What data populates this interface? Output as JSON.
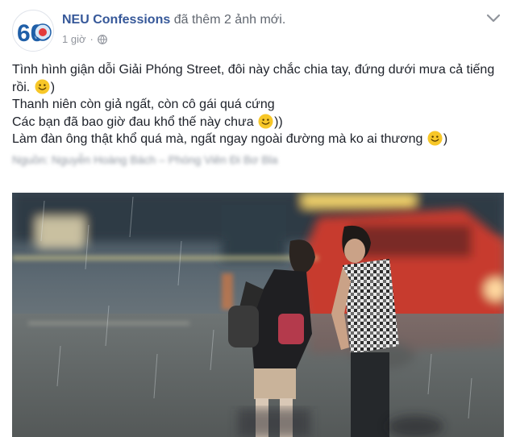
{
  "post": {
    "author_name": "NEU Confessions",
    "action_text": "đã thêm 2 ảnh mới.",
    "time": "1 giờ",
    "privacy_icon": "globe-icon",
    "options_icon": "chevron-down-icon"
  },
  "avatar": {
    "badge_number": "60"
  },
  "body": {
    "line1": "Tình hình giận dỗi Giải Phóng Street, đôi này chắc chia tay, đứng dưới mưa cả tiếng rồi.",
    "line1_tail": ")",
    "line2": "Thanh niên còn giả ngất, còn cô gái quá cứng",
    "line3": "Các bạn đã bao giờ đau khổ thế này chưa",
    "line3_tail": "))",
    "line4": "Làm đàn ông thật khổ quá mà, ngất ngay ngoài đường mà ko ai thương",
    "line4_tail": ")",
    "smiley_icon": "smiley-emoji-icon",
    "blurred_credit": "Nguồn: Nguyễn Hoàng Bách – Phóng Viên Đi Bơ Blak"
  },
  "photo": {
    "description_icon": "photo-rainy-street-couple"
  },
  "colors": {
    "link": "#365899",
    "secondary_text": "#616770",
    "meta_text": "#90949c",
    "smiley_yellow": "#f7c728"
  }
}
